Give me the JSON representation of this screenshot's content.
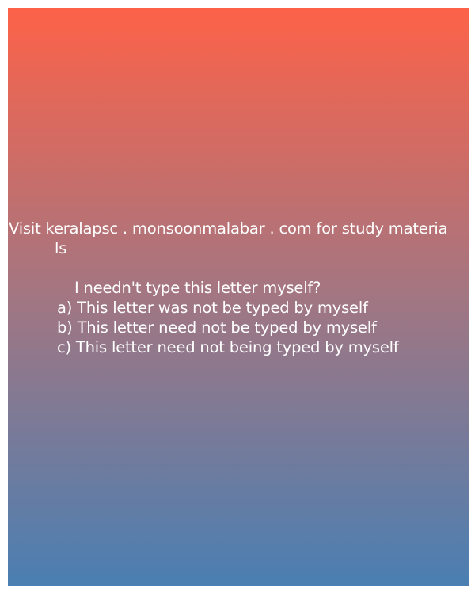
{
  "card": {
    "gradient_top": "#fd6248",
    "gradient_middle": "#a27682",
    "gradient_bottom": "#4a7fb2",
    "text_color": "#ffffff"
  },
  "watermark": {
    "line1": "Visit keralapsc . monsoonmalabar . com for study materia",
    "line2": "ls"
  },
  "question": {
    "prompt": "I needn't type this letter myself?",
    "options": [
      "a) This letter was not be typed by myself",
      "b) This letter need not be typed by myself",
      "c) This letter need not being typed by myself"
    ]
  }
}
